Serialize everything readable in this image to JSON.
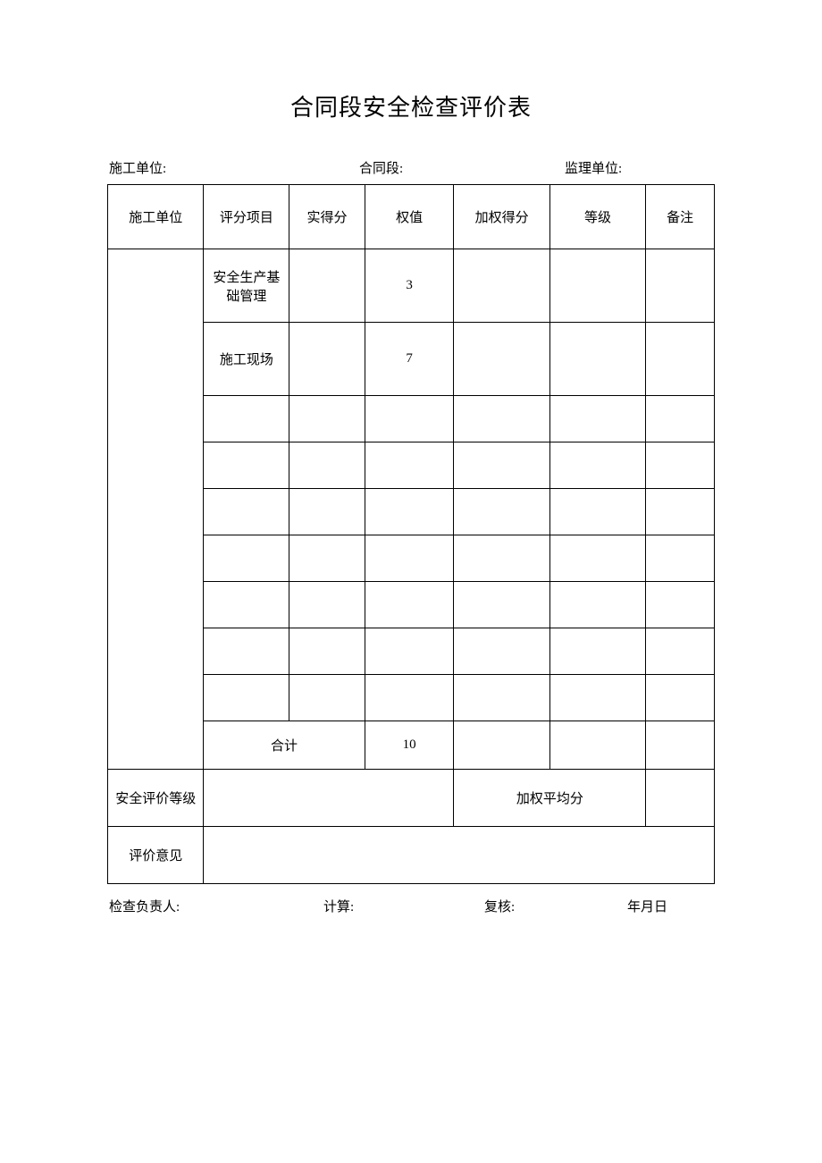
{
  "title": "合同段安全检查评价表",
  "header": {
    "unit_label": "施工单位:",
    "section_label": "合同段:",
    "supervisor_label": "监理单位:"
  },
  "table": {
    "cols": {
      "unit": "施工单位",
      "item": "评分项目",
      "score": "实得分",
      "weight": "权值",
      "wscore": "加权得分",
      "grade": "等级",
      "note": "备注"
    },
    "rows": [
      {
        "item": "安全生产基础管理",
        "score": "",
        "weight": "3",
        "wscore": "",
        "grade": "",
        "note": ""
      },
      {
        "item": "施工现场",
        "score": "",
        "weight": "7",
        "wscore": "",
        "grade": "",
        "note": ""
      },
      {
        "item": "",
        "score": "",
        "weight": "",
        "wscore": "",
        "grade": "",
        "note": ""
      },
      {
        "item": "",
        "score": "",
        "weight": "",
        "wscore": "",
        "grade": "",
        "note": ""
      },
      {
        "item": "",
        "score": "",
        "weight": "",
        "wscore": "",
        "grade": "",
        "note": ""
      },
      {
        "item": "",
        "score": "",
        "weight": "",
        "wscore": "",
        "grade": "",
        "note": ""
      },
      {
        "item": "",
        "score": "",
        "weight": "",
        "wscore": "",
        "grade": "",
        "note": ""
      },
      {
        "item": "",
        "score": "",
        "weight": "",
        "wscore": "",
        "grade": "",
        "note": ""
      },
      {
        "item": "",
        "score": "",
        "weight": "",
        "wscore": "",
        "grade": "",
        "note": ""
      }
    ],
    "sum": {
      "label": "合计",
      "weight": "10",
      "wscore": "",
      "grade": "",
      "note": ""
    },
    "grade_row": {
      "label": "安全评价等级",
      "value": "",
      "avg_label": "加权平均分",
      "avg_value": ""
    },
    "opinion_row": {
      "label": "评价意见",
      "value": ""
    }
  },
  "footer": {
    "inspector": "检查负责人:",
    "calc": "计算:",
    "review": "复核:",
    "date": "年月日"
  }
}
